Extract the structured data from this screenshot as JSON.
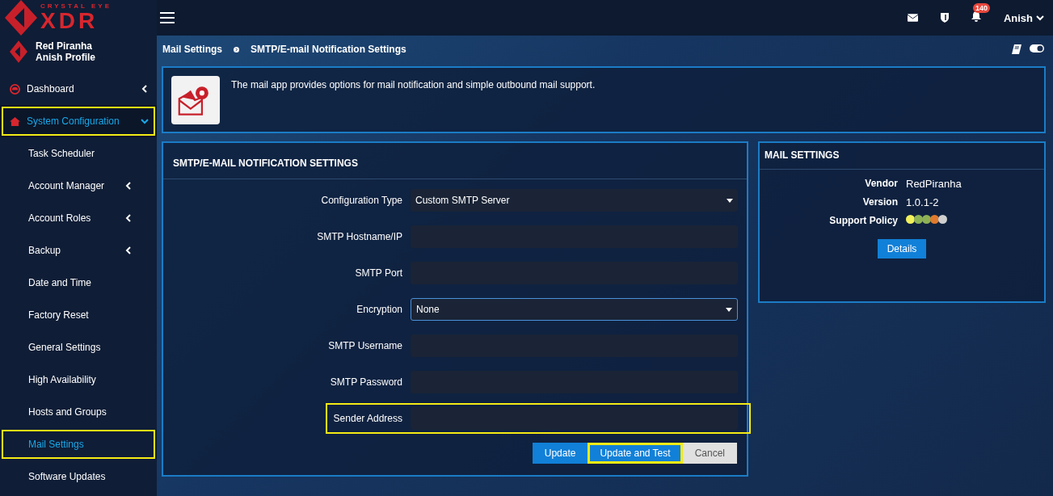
{
  "brand": {
    "tagline": "CRYSTAL EYE",
    "product": "XDR",
    "org": "Red Piranha",
    "profile": "Anish Profile"
  },
  "topbar": {
    "notification_count": "140",
    "user": "Anish"
  },
  "sidebar": {
    "items": [
      {
        "label": "Dashboard",
        "expanded": false,
        "selected": false,
        "highlighted": false,
        "caret": true
      },
      {
        "label": "System Configuration",
        "expanded": true,
        "selected": true,
        "highlighted": true,
        "caret": true,
        "children": [
          {
            "label": "Task Scheduler",
            "selected": false,
            "highlighted": false,
            "caret": false
          },
          {
            "label": "Account Manager",
            "selected": false,
            "highlighted": false,
            "caret": true
          },
          {
            "label": "Account Roles",
            "selected": false,
            "highlighted": false,
            "caret": true
          },
          {
            "label": "Backup",
            "selected": false,
            "highlighted": false,
            "caret": true
          },
          {
            "label": "Date and Time",
            "selected": false,
            "highlighted": false,
            "caret": false
          },
          {
            "label": "Factory Reset",
            "selected": false,
            "highlighted": false,
            "caret": false
          },
          {
            "label": "General Settings",
            "selected": false,
            "highlighted": false,
            "caret": false
          },
          {
            "label": "High Availability",
            "selected": false,
            "highlighted": false,
            "caret": false
          },
          {
            "label": "Hosts and Groups",
            "selected": false,
            "highlighted": false,
            "caret": false
          },
          {
            "label": "Mail Settings",
            "selected": true,
            "highlighted": true,
            "caret": false
          },
          {
            "label": "Software Updates",
            "selected": false,
            "highlighted": false,
            "caret": false
          }
        ]
      }
    ]
  },
  "breadcrumb": [
    "Mail Settings",
    "SMTP/E-mail Notification Settings"
  ],
  "info": {
    "text": "The mail app provides options for mail notification and simple outbound mail support."
  },
  "form": {
    "title": "SMTP/E-MAIL NOTIFICATION SETTINGS",
    "fields": [
      {
        "label": "Configuration Type",
        "kind": "select",
        "value": "Custom SMTP Server",
        "focused": false,
        "highlighted": false
      },
      {
        "label": "SMTP Hostname/IP",
        "kind": "text",
        "focused": false,
        "highlighted": false
      },
      {
        "label": "SMTP Port",
        "kind": "text",
        "focused": false,
        "highlighted": false
      },
      {
        "label": "Encryption",
        "kind": "select",
        "value": "None",
        "focused": true,
        "highlighted": false
      },
      {
        "label": "SMTP Username",
        "kind": "text",
        "focused": false,
        "highlighted": false
      },
      {
        "label": "SMTP Password",
        "kind": "text",
        "focused": false,
        "highlighted": false
      },
      {
        "label": "Sender Address",
        "kind": "text",
        "focused": false,
        "highlighted": true
      }
    ],
    "buttons": [
      {
        "label": "Update",
        "kind": "primary",
        "highlighted": false
      },
      {
        "label": "Update and Test",
        "kind": "primary",
        "highlighted": true
      },
      {
        "label": "Cancel",
        "kind": "default",
        "highlighted": false
      }
    ]
  },
  "app_info": {
    "title": "MAIL SETTINGS",
    "rows": [
      {
        "label": "Vendor",
        "value": "RedPiranha"
      },
      {
        "label": "Version",
        "value": "1.0.1-2"
      }
    ],
    "policy_label": "Support Policy",
    "policy_dots": [
      {
        "color": "#f2f05a"
      },
      {
        "color": "#8db255"
      },
      {
        "color": "#8db255"
      },
      {
        "color": "#e07a2e"
      },
      {
        "color": "#cfcfcf"
      }
    ],
    "button": "Details"
  }
}
